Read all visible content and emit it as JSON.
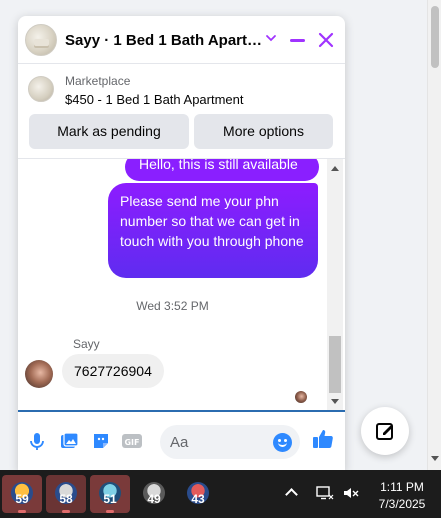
{
  "chat": {
    "title": "Sayy · 1 Bed 1 Bath Apartm...",
    "marketplace_label": "Marketplace",
    "listing": "$450 - 1 Bed 1 Bath Apartment",
    "mark_pending_label": "Mark as pending",
    "more_options_label": "More options",
    "messages": [
      {
        "direction": "outgoing",
        "text": "Hello, this is still available"
      },
      {
        "direction": "outgoing",
        "text": "Please send me your phn number so that we can get in touch with you through phone"
      }
    ],
    "timestamp": "Wed 3:52 PM",
    "incoming_sender": "Sayy",
    "incoming_message": "7627726904",
    "input_placeholder": "Aa",
    "accent_color": "#8a1fff"
  },
  "taskbar": {
    "items": [
      {
        "icon": "weather-icon",
        "value": "59",
        "active": true
      },
      {
        "icon": "weather-icon",
        "value": "58",
        "active": true
      },
      {
        "icon": "weather-icon",
        "value": "51",
        "active": true
      },
      {
        "icon": "weather-icon",
        "value": "49",
        "active": false
      },
      {
        "icon": "weather-icon",
        "value": "43",
        "active": false
      }
    ],
    "time": "1:11 PM",
    "date": "7/3/2025"
  }
}
